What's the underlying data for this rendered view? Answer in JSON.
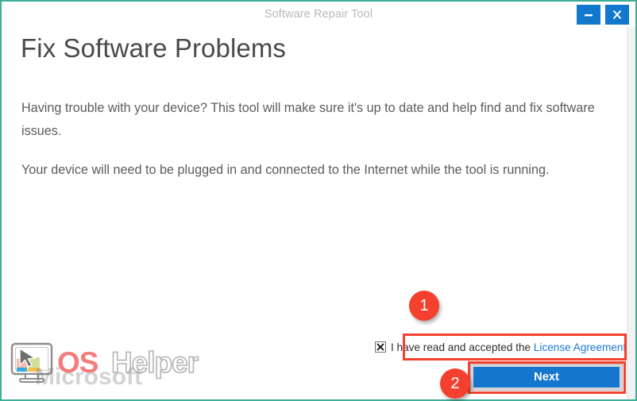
{
  "window": {
    "title": "Software Repair Tool",
    "minimize_label": "Minimize",
    "close_label": "Close",
    "minimize_icon": "minus-icon",
    "close_icon": "close-x-icon"
  },
  "content": {
    "heading": "Fix Software Problems",
    "paragraph_1": "Having trouble with your device? This tool will make sure it's up to date and help find and fix software issues.",
    "paragraph_2": "Your device will need to be plugged in and connected to the Internet while the tool is running."
  },
  "license": {
    "checkbox_checked": true,
    "checkbox_glyph": "x-mark-icon",
    "text": "I have read and accepted the ",
    "link_label": "License Agreement"
  },
  "actions": {
    "next_label": "Next"
  },
  "annotations": {
    "markers": [
      {
        "label": "1"
      },
      {
        "label": "2"
      }
    ]
  },
  "watermark": {
    "brand_os": "OS",
    "brand_helper": "Helper",
    "brand_microsoft": "Microsoft",
    "icon": "monitor-cursor-icon"
  },
  "colors": {
    "frame_border": "#3fae96",
    "accent_blue": "#1576cd",
    "caption_blue": "#1278ce",
    "link_blue": "#1b79d0",
    "annotation_red": "#f4402f",
    "heading_gray": "#4a4a4a",
    "body_gray": "#5c5c5c",
    "title_gray": "#b9b9b9"
  }
}
